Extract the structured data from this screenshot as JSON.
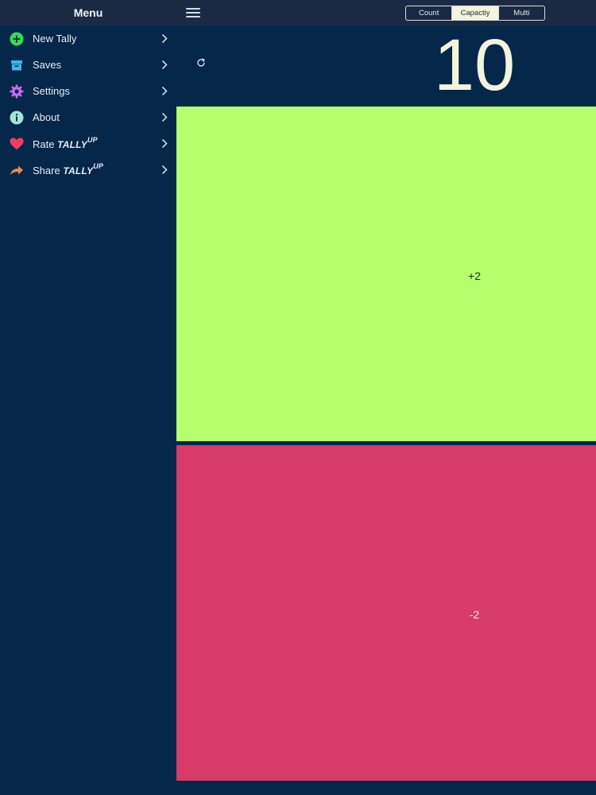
{
  "sidebar": {
    "title": "Menu",
    "items": [
      {
        "icon": "plus-circle-icon",
        "label": "New Tally",
        "color": "#38d957"
      },
      {
        "icon": "archive-box-icon",
        "label": "Saves",
        "color": "#3db7ea"
      },
      {
        "icon": "gear-icon",
        "label": "Settings",
        "color": "#c86bf0"
      },
      {
        "icon": "info-circle-icon",
        "label": "About",
        "color": "#a3e6d6"
      },
      {
        "icon": "heart-icon",
        "label": "Rate",
        "brand": "TALLY",
        "brand_sup": "UP",
        "color": "#ee3d64"
      },
      {
        "icon": "share-arrow-icon",
        "label": "Share",
        "brand": "TALLY",
        "brand_sup": "UP",
        "color": "#f2894a"
      }
    ]
  },
  "toolbar": {
    "tabs": [
      "Count",
      "Capactiy",
      "Multi"
    ],
    "active_tab": "Capactiy"
  },
  "counter": {
    "value": "10",
    "increment_label": "+2",
    "decrement_label": "-2",
    "increment_color": "#b6ff6c",
    "decrement_color": "#d73c68"
  }
}
